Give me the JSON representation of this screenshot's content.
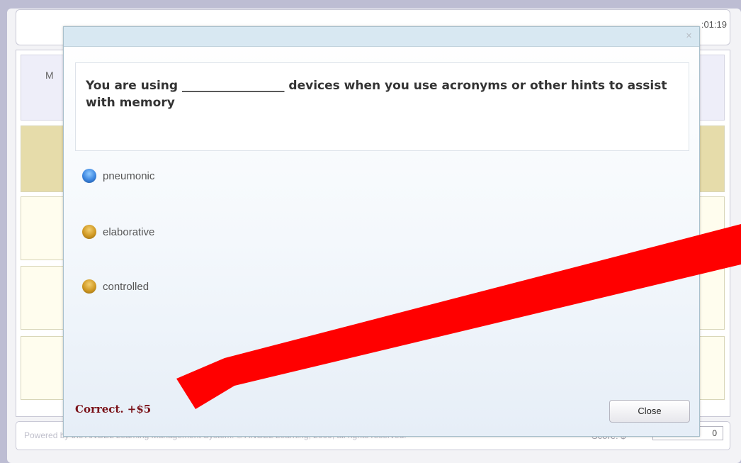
{
  "timer": ":01:19",
  "board": {
    "header_letter": "M"
  },
  "footer": {
    "copyright": "Powered by the ANGEL Learning Management System. © ANGEL Learning, 2009, all rights reserved.",
    "score_label": "Score: $",
    "score_value": "0"
  },
  "modal": {
    "close_icon": "x-icon",
    "question": "You are using _________________ devices when you use acronyms or other hints to assist with memory",
    "options": [
      {
        "label": "pneumonic",
        "selected": true
      },
      {
        "label": "elaborative",
        "selected": false
      },
      {
        "label": "controlled",
        "selected": false
      }
    ],
    "feedback": "Correct. +$5",
    "close_label": "Close"
  },
  "colors": {
    "feedback": "#7a1219",
    "annotation_arrow": "#ff0000",
    "selected_radio": "#3c86e0",
    "unselected_radio": "#cf9822"
  }
}
